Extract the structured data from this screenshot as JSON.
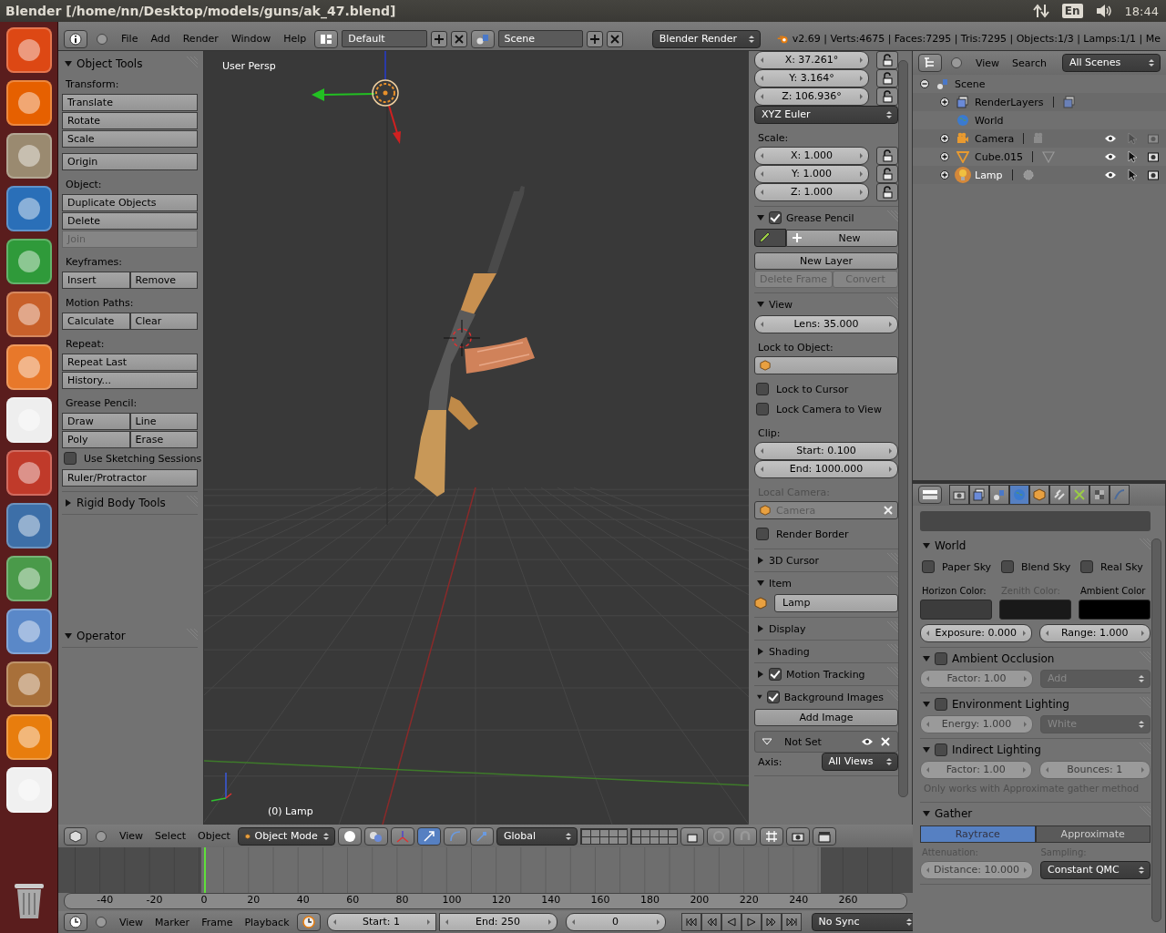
{
  "os_bar": {
    "title": "Blender [/home/nn/Desktop/models/guns/ak_47.blend]",
    "keyboard_layout": "En",
    "clock": "18:44"
  },
  "info_header": {
    "menus": [
      "File",
      "Add",
      "Render",
      "Window",
      "Help"
    ],
    "screen_layout": "Default",
    "scene": "Scene",
    "render_engine": "Blender Render",
    "stats": "v2.69 | Verts:4675 | Faces:7295 | Tris:7295 | Objects:1/3 | Lamps:1/1 | Me"
  },
  "tool_shelf": {
    "panels": [
      {
        "title": "Object Tools",
        "expanded": true,
        "groups": [
          {
            "rows": [
              {
                "items": [
                  {
                    "kind": "label",
                    "label": "Transform:"
                  }
                ]
              },
              {
                "items": [
                  {
                    "kind": "button",
                    "label": "Translate",
                    "disabled": false
                  }
                ]
              },
              {
                "items": [
                  {
                    "kind": "button",
                    "label": "Rotate",
                    "disabled": false
                  }
                ]
              },
              {
                "items": [
                  {
                    "kind": "button",
                    "label": "Scale",
                    "disabled": false
                  }
                ]
              }
            ]
          },
          {
            "rows": [
              {
                "items": [
                  {
                    "kind": "button",
                    "label": "Origin",
                    "disabled": false
                  }
                ]
              }
            ]
          },
          {
            "rows": [
              {
                "items": [
                  {
                    "kind": "label",
                    "label": "Object:"
                  }
                ]
              },
              {
                "items": [
                  {
                    "kind": "button",
                    "label": "Duplicate Objects",
                    "disabled": false
                  }
                ]
              },
              {
                "items": [
                  {
                    "kind": "button",
                    "label": "Delete",
                    "disabled": false
                  }
                ]
              },
              {
                "items": [
                  {
                    "kind": "button",
                    "label": "Join",
                    "disabled": true
                  }
                ]
              }
            ]
          },
          {
            "rows": [
              {
                "items": [
                  {
                    "kind": "label",
                    "label": "Keyframes:"
                  }
                ]
              },
              {
                "items": [
                  {
                    "kind": "button",
                    "label": "Insert",
                    "disabled": false
                  },
                  {
                    "kind": "button",
                    "label": "Remove",
                    "disabled": false
                  }
                ]
              }
            ]
          },
          {
            "rows": [
              {
                "items": [
                  {
                    "kind": "label",
                    "label": "Motion Paths:"
                  }
                ]
              },
              {
                "items": [
                  {
                    "kind": "button",
                    "label": "Calculate",
                    "disabled": false
                  },
                  {
                    "kind": "button",
                    "label": "Clear",
                    "disabled": false
                  }
                ]
              }
            ]
          },
          {
            "rows": [
              {
                "items": [
                  {
                    "kind": "label",
                    "label": "Repeat:"
                  }
                ]
              },
              {
                "items": [
                  {
                    "kind": "button",
                    "label": "Repeat Last",
                    "disabled": false
                  }
                ]
              },
              {
                "items": [
                  {
                    "kind": "button",
                    "label": "History...",
                    "disabled": false
                  }
                ]
              }
            ]
          },
          {
            "rows": [
              {
                "items": [
                  {
                    "kind": "label",
                    "label": "Grease Pencil:"
                  }
                ]
              },
              {
                "items": [
                  {
                    "kind": "button",
                    "label": "Draw",
                    "disabled": false
                  },
                  {
                    "kind": "button",
                    "label": "Line",
                    "disabled": false
                  }
                ]
              },
              {
                "items": [
                  {
                    "kind": "button",
                    "label": "Poly",
                    "disabled": false
                  },
                  {
                    "kind": "button",
                    "label": "Erase",
                    "disabled": false
                  }
                ]
              },
              {
                "items": [
                  {
                    "kind": "checkbox",
                    "label": "Use Sketching Sessions",
                    "checked": false
                  }
                ]
              },
              {
                "items": [
                  {
                    "kind": "button",
                    "label": "Ruler/Protractor",
                    "disabled": false
                  }
                ]
              }
            ]
          }
        ]
      },
      {
        "title": "Rigid Body Tools",
        "expanded": false
      }
    ],
    "operator_panels": [
      {
        "title": "Operator",
        "expanded": true
      }
    ]
  },
  "viewport": {
    "view_label": "User Persp",
    "object_label": "(0) Lamp"
  },
  "sidebar": {
    "panels": [
      {
        "groups": [
          {
            "rows": [
              {
                "items": [
                  {
                    "kind": "number",
                    "label": "X: 37.261°"
                  },
                  {
                    "kind": "lock",
                    "locked": false
                  }
                ]
              },
              {
                "items": [
                  {
                    "kind": "number",
                    "label": "Y: 3.164°"
                  },
                  {
                    "kind": "lock",
                    "locked": false
                  }
                ]
              },
              {
                "items": [
                  {
                    "kind": "number",
                    "label": "Z: 106.936°"
                  },
                  {
                    "kind": "lock",
                    "locked": false
                  }
                ]
              },
              {
                "items": [
                  {
                    "kind": "dropdown",
                    "label": "XYZ Euler"
                  }
                ]
              }
            ]
          },
          {
            "rows": [
              {
                "items": [
                  {
                    "kind": "label",
                    "label": "Scale:"
                  }
                ]
              },
              {
                "items": [
                  {
                    "kind": "number",
                    "label": "X: 1.000"
                  },
                  {
                    "kind": "lock",
                    "locked": false
                  }
                ]
              },
              {
                "items": [
                  {
                    "kind": "number",
                    "label": "Y: 1.000"
                  },
                  {
                    "kind": "lock",
                    "locked": false
                  }
                ]
              },
              {
                "items": [
                  {
                    "kind": "number",
                    "label": "Z: 1.000"
                  },
                  {
                    "kind": "lock",
                    "locked": false
                  }
                ]
              }
            ]
          }
        ]
      },
      {
        "title": "Grease Pencil",
        "expanded": true,
        "checked": true,
        "groups": [
          {
            "rows": [
              {
                "items": [
                  {
                    "kind": "pencil_menu"
                  },
                  {
                    "kind": "add_button",
                    "label": "New"
                  }
                ]
              }
            ]
          },
          {
            "rows": [
              {
                "items": [
                  {
                    "kind": "button",
                    "label": "New Layer",
                    "disabled": false
                  }
                ]
              },
              {
                "items": [
                  {
                    "kind": "button",
                    "label": "Delete Frame",
                    "disabled": true
                  },
                  {
                    "kind": "button",
                    "label": "Convert",
                    "disabled": true
                  }
                ]
              }
            ]
          }
        ]
      },
      {
        "title": "View",
        "expanded": true,
        "groups": [
          {
            "rows": [
              {
                "items": [
                  {
                    "kind": "number",
                    "label": "Lens: 35.000"
                  }
                ]
              }
            ]
          },
          {
            "rows": [
              {
                "items": [
                  {
                    "kind": "label",
                    "label": "Lock to Object:"
                  }
                ]
              },
              {
                "items": [
                  {
                    "kind": "object_field",
                    "removable": false
                  }
                ]
              }
            ]
          },
          {
            "rows": [
              {
                "items": [
                  {
                    "kind": "checkbox",
                    "label": "Lock to Cursor",
                    "checked": false
                  }
                ]
              },
              {
                "items": [
                  {
                    "kind": "checkbox",
                    "label": "Lock Camera to View",
                    "checked": false
                  }
                ]
              }
            ]
          },
          {
            "rows": [
              {
                "items": [
                  {
                    "kind": "label",
                    "label": "Clip:"
                  }
                ]
              },
              {
                "items": [
                  {
                    "kind": "number",
                    "label": "Start: 0.100"
                  }
                ]
              },
              {
                "items": [
                  {
                    "kind": "number",
                    "label": "End: 1000.000"
                  }
                ]
              }
            ]
          },
          {
            "rows": [
              {
                "items": [
                  {
                    "kind": "label",
                    "label": "Local Camera:",
                    "disabled": true
                  }
                ]
              },
              {
                "items": [
                  {
                    "kind": "object_field",
                    "label": "Camera",
                    "removable": true,
                    "disabled": true
                  }
                ]
              }
            ]
          },
          {
            "rows": [
              {
                "items": [
                  {
                    "kind": "checkbox",
                    "label": "Render Border",
                    "checked": false
                  }
                ]
              }
            ]
          }
        ]
      },
      {
        "title": "3D Cursor",
        "expanded": false
      },
      {
        "title": "Item",
        "expanded": true,
        "groups": [
          {
            "rows": [
              {
                "items": [
                  {
                    "kind": "cube_icon"
                  },
                  {
                    "kind": "text_field",
                    "label": "Lamp"
                  }
                ]
              }
            ]
          }
        ]
      },
      {
        "title": "Display",
        "expanded": false
      },
      {
        "title": "Shading",
        "expanded": false
      },
      {
        "title": "Motion Tracking",
        "expanded": false,
        "checked": true
      },
      {
        "title": "Background Images",
        "expanded": true,
        "checked": true,
        "groups": [
          {
            "rows": [
              {
                "items": [
                  {
                    "kind": "button",
                    "label": "Add Image",
                    "disabled": false
                  }
                ]
              }
            ]
          },
          {
            "rows": [
              {
                "items": [
                  {
                    "kind": "image_entry",
                    "label": "Not Set"
                  }
                ]
              },
              {
                "items": [
                  {
                    "kind": "label",
                    "label": "Axis:"
                  },
                  {
                    "kind": "dropdown",
                    "label": "All Views"
                  }
                ]
              }
            ]
          }
        ]
      }
    ]
  },
  "outliner": {
    "menus": [
      "View",
      "Search"
    ],
    "filter": "All Scenes",
    "tree": [
      {
        "label": "Scene",
        "kind": "scene",
        "expanded": true,
        "selected": false,
        "children": [
          {
            "label": "RenderLayers",
            "kind": "layers",
            "expanded": false,
            "selected": false
          },
          {
            "label": "World",
            "kind": "world",
            "selected": false
          },
          {
            "label": "Camera",
            "kind": "camera",
            "expanded": false,
            "selected": false,
            "visible": true,
            "selectable": false
          },
          {
            "label": "Cube.015",
            "kind": "mesh",
            "expanded": false,
            "selected": false,
            "visible": true,
            "selectable": true
          },
          {
            "label": "Lamp",
            "kind": "lamp",
            "expanded": false,
            "selected": true,
            "visible": true,
            "selectable": true
          }
        ]
      }
    ]
  },
  "properties": {
    "tabs": [
      {
        "kind": "render",
        "selected": false
      },
      {
        "kind": "layers",
        "selected": false
      },
      {
        "kind": "scene",
        "selected": false
      },
      {
        "kind": "world",
        "selected": true
      },
      {
        "kind": "object",
        "selected": false
      },
      {
        "kind": "constraints",
        "selected": false
      },
      {
        "kind": "data",
        "selected": false
      },
      {
        "kind": "texture",
        "selected": false
      },
      {
        "kind": "physics",
        "selected": false
      }
    ],
    "panels": [
      {
        "title": "World",
        "expanded": true,
        "groups": [
          {
            "rows": [
              {
                "items": [
                  {
                    "kind": "checkbox",
                    "label": "Paper Sky",
                    "checked": false
                  },
                  {
                    "kind": "checkbox",
                    "label": "Blend Sky",
                    "checked": false
                  },
                  {
                    "kind": "checkbox",
                    "label": "Real Sky",
                    "checked": false
                  }
                ]
              }
            ]
          },
          {
            "rows": [
              {
                "items": [
                  {
                    "kind": "label",
                    "label": "Horizon Color:"
                  },
                  {
                    "kind": "label",
                    "label": "Zenith Color:",
                    "disabled": true
                  },
                  {
                    "kind": "label",
                    "label": "Ambient Color"
                  }
                ]
              },
              {
                "items": [
                  {
                    "kind": "swatch",
                    "color": "#3c3c3c"
                  },
                  {
                    "kind": "swatch",
                    "color": "#191919"
                  },
                  {
                    "kind": "swatch",
                    "color": "#000000"
                  }
                ]
              }
            ]
          },
          {
            "rows": [
              {
                "items": [
                  {
                    "kind": "number",
                    "label": "Exposure: 0.000"
                  },
                  {
                    "kind": "number",
                    "label": "Range: 1.000"
                  }
                ]
              }
            ]
          }
        ]
      },
      {
        "title": "Ambient Occlusion",
        "expanded": true,
        "checked": false,
        "groups": [
          {
            "rows": [
              {
                "items": [
                  {
                    "kind": "number",
                    "label": "Factor: 1.00",
                    "disabled": true
                  },
                  {
                    "kind": "dropdown",
                    "label": "Add",
                    "disabled": true
                  }
                ]
              }
            ]
          }
        ]
      },
      {
        "title": "Environment Lighting",
        "expanded": true,
        "checked": false,
        "groups": [
          {
            "rows": [
              {
                "items": [
                  {
                    "kind": "number",
                    "label": "Energy: 1.000",
                    "disabled": true
                  },
                  {
                    "kind": "dropdown",
                    "label": "White",
                    "disabled": true
                  }
                ]
              }
            ]
          }
        ]
      },
      {
        "title": "Indirect Lighting",
        "expanded": true,
        "checked": false,
        "groups": [
          {
            "rows": [
              {
                "items": [
                  {
                    "kind": "number",
                    "label": "Factor: 1.00",
                    "disabled": true
                  },
                  {
                    "kind": "number",
                    "label": "Bounces: 1",
                    "disabled": true
                  }
                ]
              },
              {
                "items": [
                  {
                    "kind": "note",
                    "label": "Only works with Approximate gather method",
                    "disabled": true
                  }
                ]
              }
            ]
          }
        ]
      },
      {
        "title": "Gather",
        "expanded": true,
        "groups": [
          {
            "rows": [
              {
                "items": [
                  {
                    "kind": "toggle",
                    "label": "Raytrace",
                    "selected": true
                  },
                  {
                    "kind": "toggle",
                    "label": "Approximate",
                    "selected": false
                  }
                ]
              },
              {
                "items": [
                  {
                    "kind": "label",
                    "label": "Attenuation:",
                    "disabled": true
                  },
                  {
                    "kind": "label",
                    "label": "Sampling:",
                    "disabled": true
                  }
                ]
              },
              {
                "items": [
                  {
                    "kind": "number",
                    "label": "Distance: 10.000",
                    "disabled": true
                  },
                  {
                    "kind": "dropdown",
                    "label": "Constant QMC"
                  }
                ]
              }
            ]
          }
        ]
      }
    ]
  },
  "view3d_header": {
    "menus": [
      "View",
      "Select",
      "Object"
    ],
    "mode": "Object Mode",
    "orientation": "Global"
  },
  "timeline": {
    "ticks": [
      "-40",
      "-20",
      "0",
      "20",
      "40",
      "60",
      "80",
      "100",
      "120",
      "140",
      "160",
      "180",
      "200",
      "220",
      "240",
      "260"
    ]
  },
  "timeline_header": {
    "menus": [
      "View",
      "Marker",
      "Frame",
      "Playback"
    ],
    "start": "Start: 1",
    "end": "End: 250",
    "frame": "0",
    "sync": "No Sync"
  }
}
